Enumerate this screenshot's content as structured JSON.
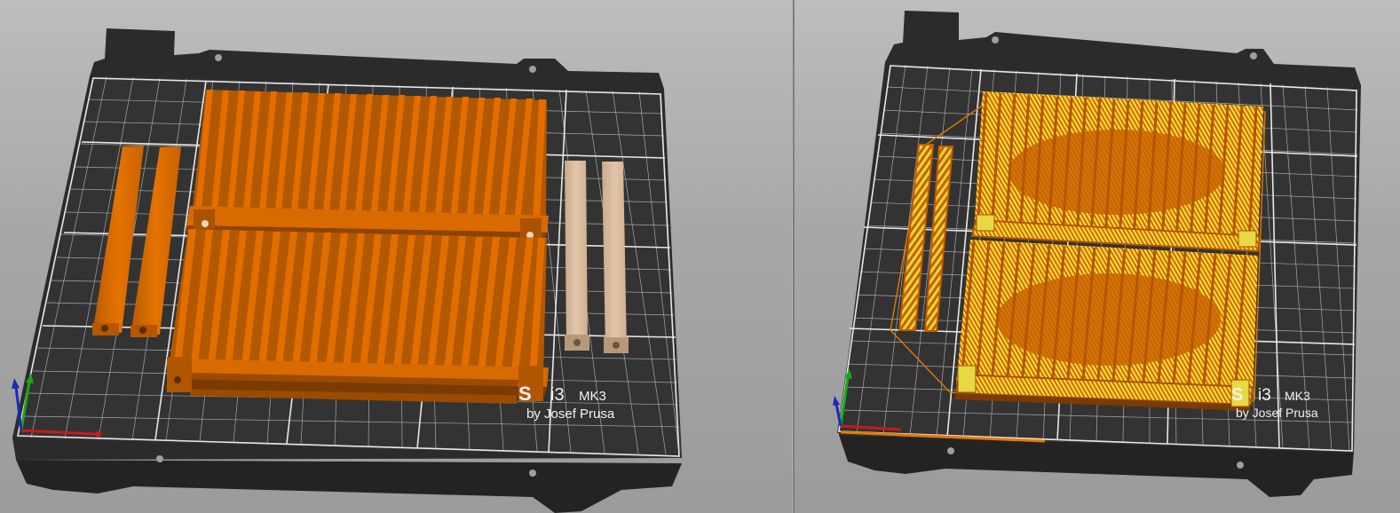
{
  "left_view": {
    "bed_logo": {
      "model": "i3",
      "submodel": "MK3",
      "byline": "by Josef Prusa"
    }
  },
  "right_view": {
    "bed_logo": {
      "model": "i3",
      "submodel": "MK3",
      "byline": "by Josef Prusa"
    }
  },
  "colors": {
    "background": "#a6a6a6",
    "bed": "#2e2e2e",
    "grid": "#d8d8d8",
    "object": "#de6b00",
    "object_dark": "#8a4200",
    "object_selected": "#d8b899",
    "infill": "#e7e23a",
    "axis_x": "#c81a1a",
    "axis_y": "#1aa61a",
    "axis_z": "#1a2ab8"
  },
  "icons": [
    "axis-gizmo-icon"
  ]
}
